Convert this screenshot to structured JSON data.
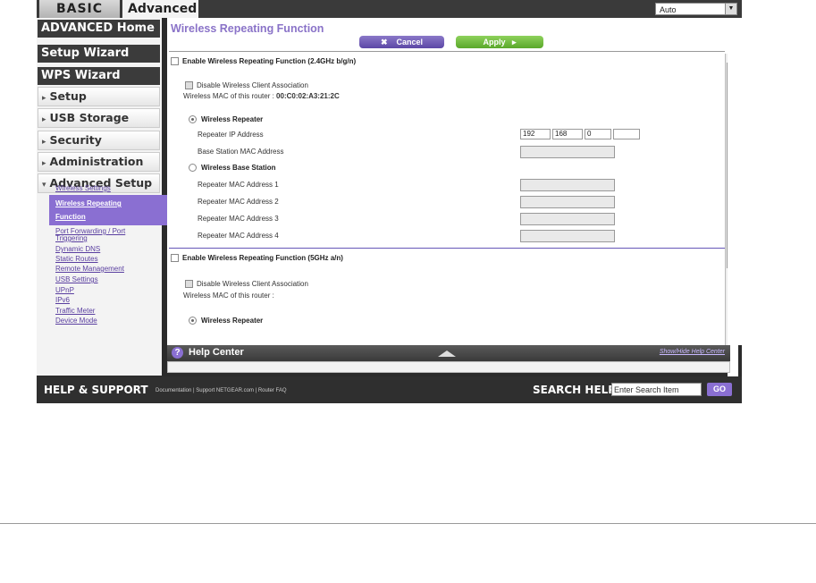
{
  "tabs": {
    "basic": "BASIC",
    "advanced": "Advanced"
  },
  "language_select": {
    "value": "Auto"
  },
  "sidebar": {
    "advanced_home": "ADVANCED Home",
    "setup_wizard": "Setup Wizard",
    "wps_wizard": "WPS Wizard",
    "setup": "Setup",
    "usb_storage": "USB Storage",
    "security": "Security",
    "administration": "Administration",
    "advanced_setup": "Advanced Setup",
    "sublinks": {
      "wireless_settings": "Wireless Settings",
      "wireless_repeating_1": "Wireless Repeating",
      "wireless_repeating_2": "Function",
      "port_forwarding_1": "Port Forwarding / Port",
      "port_forwarding_2": "Triggering",
      "dynamic_dns": "Dynamic DNS",
      "static_routes": "Static Routes",
      "remote_management": "Remote Management",
      "usb_settings": "USB Settings",
      "upnp": "UPnP",
      "ipv6": "IPv6",
      "traffic_meter": "Traffic Meter",
      "device_mode": "Device Mode"
    }
  },
  "main": {
    "title": "Wireless Repeating Function",
    "cancel": "Cancel",
    "apply": "Apply",
    "section_24": {
      "enable_label": "Enable Wireless Repeating Function (2.4GHz b/g/n)",
      "disable_client": "Disable Wireless Client Association",
      "mac_label": "Wireless MAC of this router :",
      "mac_value": "00:C0:02:A3:21:2C",
      "wireless_repeater": "Wireless Repeater",
      "repeater_ip": "Repeater IP Address",
      "ip_octets": [
        "192",
        "168",
        "0",
        ""
      ],
      "base_station_mac": "Base Station MAC Address",
      "wireless_base_station": "Wireless Base Station",
      "repeater_mac_1": "Repeater MAC Address 1",
      "repeater_mac_2": "Repeater MAC Address 2",
      "repeater_mac_3": "Repeater MAC Address 3",
      "repeater_mac_4": "Repeater MAC Address 4"
    },
    "section_5": {
      "enable_label": "Enable Wireless Repeating Function (5GHz a/n)",
      "disable_client": "Disable Wireless Client Association",
      "mac_label": "Wireless MAC of this router :",
      "wireless_repeater": "Wireless Repeater"
    }
  },
  "help": {
    "title": "Help Center",
    "toggle": "Show/Hide Help Center"
  },
  "footer": {
    "title": "HELP & SUPPORT",
    "links": "Documentation | Support NETGEAR.com | Router FAQ",
    "search_label": "SEARCH HELP",
    "search_placeholder": "Enter Search Item",
    "go": "GO"
  }
}
